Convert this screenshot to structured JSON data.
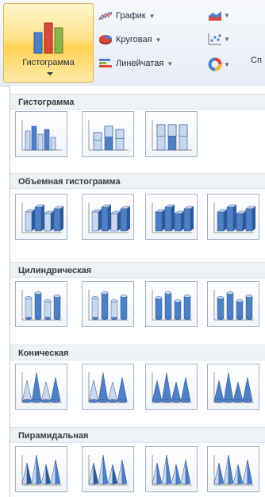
{
  "ribbon": {
    "histogram_button": {
      "label": "Гистограмма",
      "icon": "column-chart-icon"
    },
    "graph_button": {
      "label": "График",
      "icon": "line-chart-icon"
    },
    "pie_button": {
      "label": "Круговая",
      "icon": "pie-chart-icon"
    },
    "bar_button": {
      "label": "Линейчатая",
      "icon": "bar-chart-icon"
    },
    "area_button": {
      "icon": "area-chart-icon"
    },
    "scatter_button": {
      "icon": "scatter-chart-icon"
    },
    "other_button": {
      "icon": "doughnut-chart-icon"
    },
    "cut_label": "Сп"
  },
  "gallery": {
    "sections": [
      {
        "title": "Гистограмма",
        "kind": "flat-column",
        "tiles": 3
      },
      {
        "title": "Объемная гистограмма",
        "kind": "3d-column",
        "tiles": 4
      },
      {
        "title": "Цилиндрическая",
        "kind": "cylinder",
        "tiles": 4
      },
      {
        "title": "Коническая",
        "kind": "cone",
        "tiles": 4
      },
      {
        "title": "Пирамидальная",
        "kind": "pyramid",
        "tiles": 4
      }
    ]
  },
  "colors": {
    "selected_bg": "#ffe28a",
    "selected_border": "#e0b34b",
    "section_bg": "#eef1f5",
    "tile_border": "#9fb0c6",
    "bar_blue": "#4f7fc4"
  }
}
